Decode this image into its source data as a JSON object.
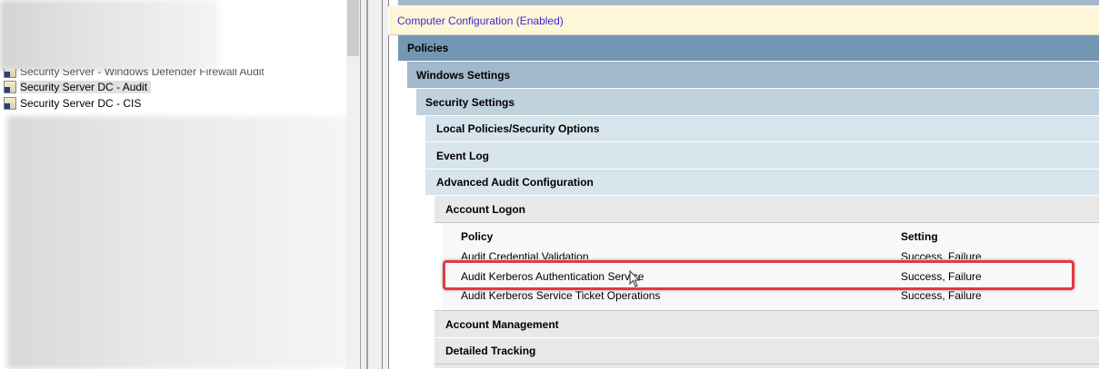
{
  "tree": {
    "items": [
      {
        "label": "Security Server - Windows Defender Firewall Audit",
        "selected": false
      },
      {
        "label": "Security Server DC - Audit",
        "selected": true
      },
      {
        "label": "Security Server DC - CIS",
        "selected": false
      }
    ]
  },
  "report": {
    "computer_config": "Computer Configuration (Enabled)",
    "policies": "Policies",
    "windows_settings": "Windows Settings",
    "security_settings": "Security Settings",
    "local_policies": "Local Policies/Security Options",
    "event_log": "Event Log",
    "advanced_audit": "Advanced Audit Configuration",
    "account_logon": "Account Logon",
    "table": {
      "headers": [
        "Policy",
        "Setting"
      ],
      "rows": [
        {
          "policy": "Audit Credential Validation",
          "setting": "Success, Failure"
        },
        {
          "policy": "Audit Kerberos Authentication Service",
          "setting": "Success, Failure"
        },
        {
          "policy": "Audit Kerberos Service Ticket Operations",
          "setting": "Success, Failure"
        }
      ]
    },
    "account_management": "Account Management",
    "detailed_tracking": "Detailed Tracking"
  },
  "colors": {
    "highlight": "#e8373d",
    "computer_config_text": "#3b2bd0",
    "computer_config_bg": "#fdf6d8"
  }
}
